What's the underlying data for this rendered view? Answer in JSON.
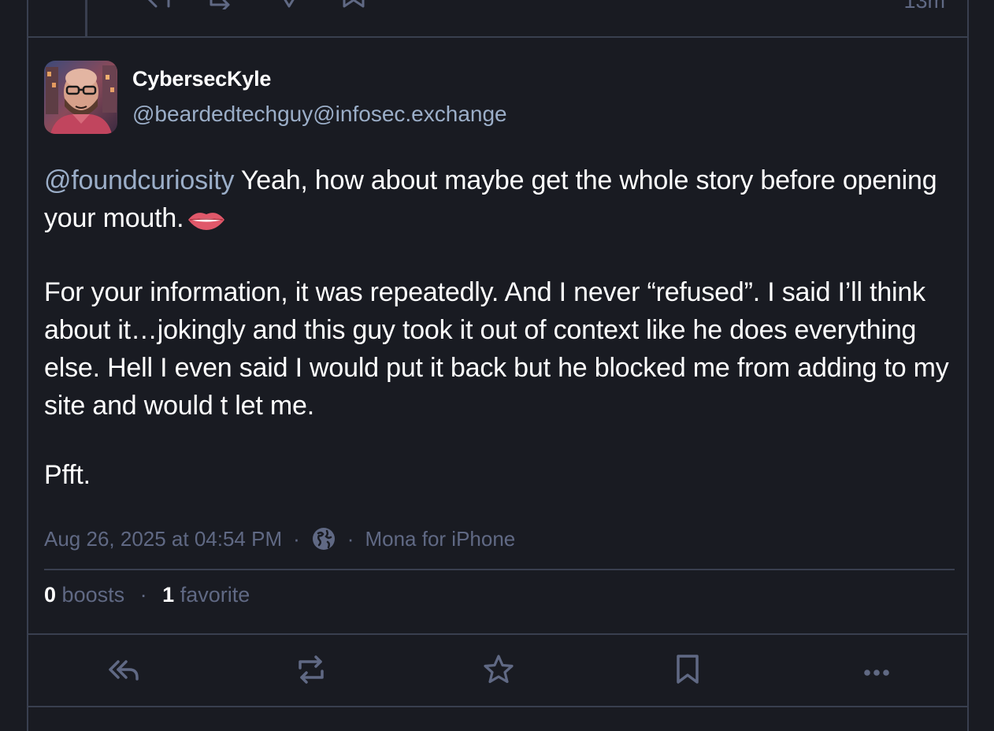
{
  "previous_post": {
    "time_label": "13m"
  },
  "post": {
    "author": {
      "display_name": "CybersecKyle",
      "handle": "@beardedtechguy@infosec.exchange"
    },
    "mention": "@foundcuriosity",
    "paragraphs": [
      " Yeah, how about maybe get the whole story before opening your mouth.",
      "For your information, it was repeatedly. And I never “refused”. I said I’ll think about it…jokingly and this guy took it out of context like he does everything else. Hell I even said I would put it back but he blocked me from adding to my site and would t let me.",
      "Pfft."
    ],
    "emoji_name": "lips-emoji",
    "timestamp": "Aug 26, 2025 at 04:54 PM",
    "separator": "·",
    "visibility_icon": "globe-icon",
    "client": "Mona for iPhone",
    "stats": {
      "boosts_count": "0",
      "boosts_label": "boosts",
      "favorites_count": "1",
      "favorites_label": "favorite"
    }
  },
  "actions": [
    "reply-icon",
    "boost-icon",
    "favorite-icon",
    "bookmark-icon",
    "more-icon"
  ],
  "colors": {
    "background": "#191b22",
    "border": "#393f4f",
    "text": "#ffffff",
    "accent": "#9baec8",
    "muted": "#606984"
  }
}
